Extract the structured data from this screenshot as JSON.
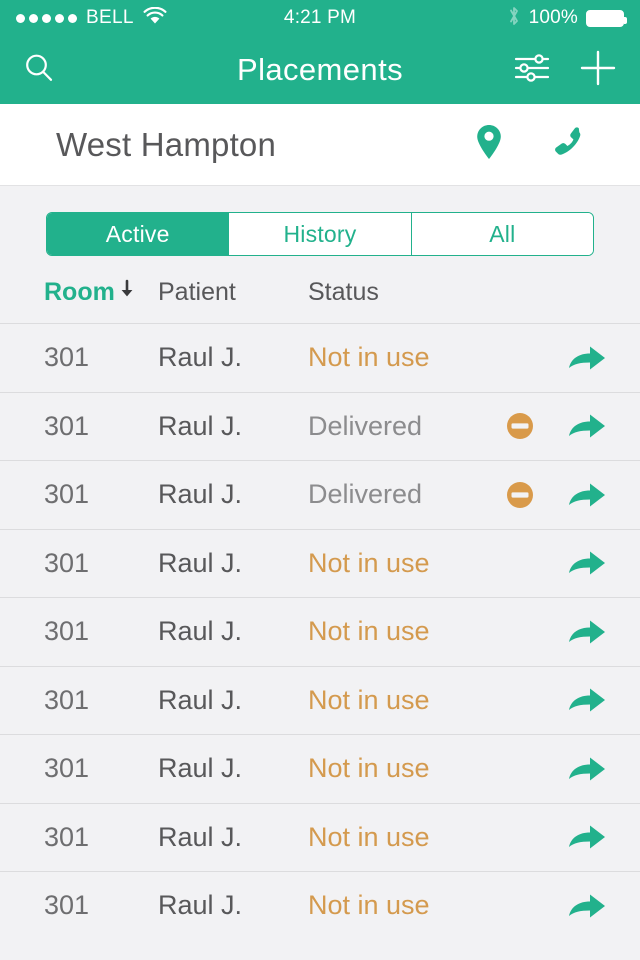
{
  "status_bar": {
    "signal_dots": 5,
    "carrier": "BELL",
    "wifi_icon": "wifi-icon",
    "time": "4:21 PM",
    "bluetooth_icon": "bluetooth-icon",
    "battery_percent": "100%",
    "battery_icon": "battery-full-icon"
  },
  "nav_bar": {
    "search_icon": "search-icon",
    "title": "Placements",
    "filter_icon": "filter-sliders-icon",
    "add_icon": "plus-icon"
  },
  "facility": {
    "name": "West Hampton",
    "location_icon": "map-pin-icon",
    "phone_icon": "phone-icon"
  },
  "segmented_control": {
    "selected": "Active",
    "options": [
      {
        "label": "Active",
        "selected": true
      },
      {
        "label": "History",
        "selected": false
      },
      {
        "label": "All",
        "selected": false
      }
    ]
  },
  "table": {
    "columns": [
      {
        "label": "Room",
        "sorted": true,
        "sort_direction": "desc",
        "sort_icon": "arrow-down-icon"
      },
      {
        "label": "Patient",
        "sorted": false
      },
      {
        "label": "Status",
        "sorted": false
      }
    ],
    "rows": [
      {
        "room": "301",
        "patient": "Raul J.",
        "status": "Not in use",
        "status_type": "notinuse",
        "block_icon": null,
        "action_icon": "forward-arrow-icon"
      },
      {
        "room": "301",
        "patient": "Raul J.",
        "status": "Delivered",
        "status_type": "delivered",
        "block_icon": "no-entry-icon",
        "action_icon": "forward-arrow-icon"
      },
      {
        "room": "301",
        "patient": "Raul J.",
        "status": "Delivered",
        "status_type": "delivered",
        "block_icon": "no-entry-icon",
        "action_icon": "forward-arrow-icon"
      },
      {
        "room": "301",
        "patient": "Raul J.",
        "status": "Not in use",
        "status_type": "notinuse",
        "block_icon": null,
        "action_icon": "forward-arrow-icon"
      },
      {
        "room": "301",
        "patient": "Raul J.",
        "status": "Not in use",
        "status_type": "notinuse",
        "block_icon": null,
        "action_icon": "forward-arrow-icon"
      },
      {
        "room": "301",
        "patient": "Raul J.",
        "status": "Not in use",
        "status_type": "notinuse",
        "block_icon": null,
        "action_icon": "forward-arrow-icon"
      },
      {
        "room": "301",
        "patient": "Raul J.",
        "status": "Not in use",
        "status_type": "notinuse",
        "block_icon": null,
        "action_icon": "forward-arrow-icon"
      },
      {
        "room": "301",
        "patient": "Raul J.",
        "status": "Not in use",
        "status_type": "notinuse",
        "block_icon": null,
        "action_icon": "forward-arrow-icon"
      },
      {
        "room": "301",
        "patient": "Raul J.",
        "status": "Not in use",
        "status_type": "notinuse",
        "block_icon": null,
        "action_icon": "forward-arrow-icon"
      }
    ]
  },
  "colors": {
    "brand_teal": "#22B18C",
    "status_warning_orange": "#D49A4E",
    "status_neutral_gray": "#8C8C8E",
    "row_background": "#F2F2F4",
    "row_divider": "#DCDCDE",
    "text_dark": "#58585A",
    "white": "#FFFFFF"
  }
}
